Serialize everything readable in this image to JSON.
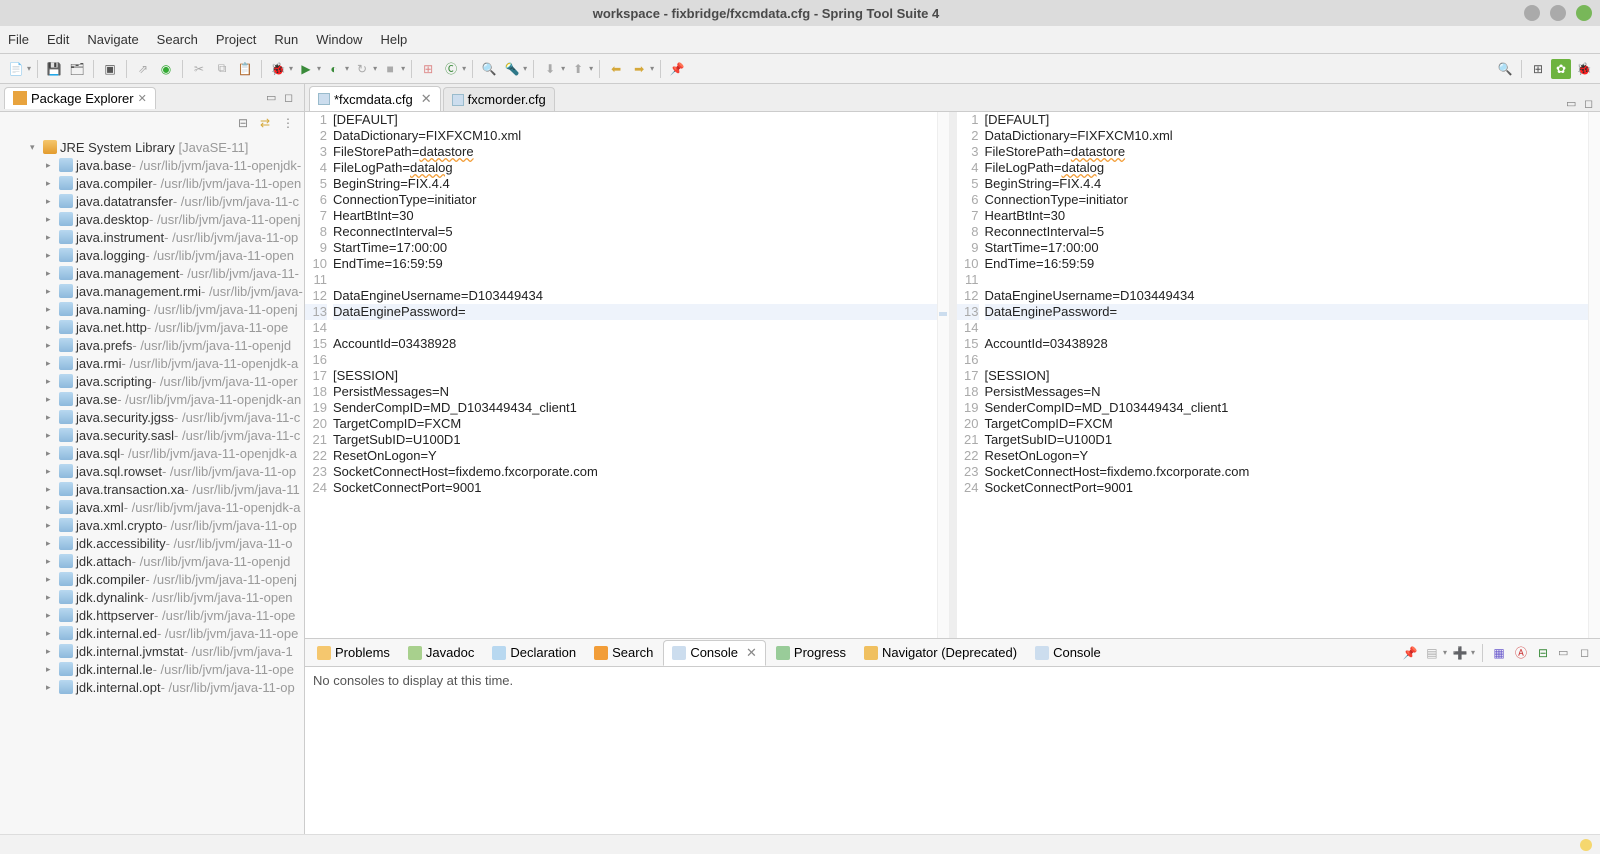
{
  "window": {
    "title": "workspace - fixbridge/fxcmdata.cfg - Spring Tool Suite 4"
  },
  "menu": [
    "File",
    "Edit",
    "Navigate",
    "Search",
    "Project",
    "Run",
    "Window",
    "Help"
  ],
  "sidebar": {
    "title": "Package Explorer",
    "library": {
      "name": "JRE System Library",
      "profile": "[JavaSE-11]"
    },
    "jars": [
      {
        "name": "java.base",
        "path": " - /usr/lib/jvm/java-11-openjdk-"
      },
      {
        "name": "java.compiler",
        "path": " - /usr/lib/jvm/java-11-open"
      },
      {
        "name": "java.datatransfer",
        "path": " - /usr/lib/jvm/java-11-c"
      },
      {
        "name": "java.desktop",
        "path": " - /usr/lib/jvm/java-11-openj"
      },
      {
        "name": "java.instrument",
        "path": " - /usr/lib/jvm/java-11-op"
      },
      {
        "name": "java.logging",
        "path": " - /usr/lib/jvm/java-11-open"
      },
      {
        "name": "java.management",
        "path": " - /usr/lib/jvm/java-11-"
      },
      {
        "name": "java.management.rmi",
        "path": " - /usr/lib/jvm/java-"
      },
      {
        "name": "java.naming",
        "path": " - /usr/lib/jvm/java-11-openj"
      },
      {
        "name": "java.net.http",
        "path": " - /usr/lib/jvm/java-11-ope"
      },
      {
        "name": "java.prefs",
        "path": " - /usr/lib/jvm/java-11-openjd"
      },
      {
        "name": "java.rmi",
        "path": " - /usr/lib/jvm/java-11-openjdk-a"
      },
      {
        "name": "java.scripting",
        "path": " - /usr/lib/jvm/java-11-oper"
      },
      {
        "name": "java.se",
        "path": " - /usr/lib/jvm/java-11-openjdk-an"
      },
      {
        "name": "java.security.jgss",
        "path": " - /usr/lib/jvm/java-11-c"
      },
      {
        "name": "java.security.sasl",
        "path": " - /usr/lib/jvm/java-11-c"
      },
      {
        "name": "java.sql",
        "path": " - /usr/lib/jvm/java-11-openjdk-a"
      },
      {
        "name": "java.sql.rowset",
        "path": " - /usr/lib/jvm/java-11-op"
      },
      {
        "name": "java.transaction.xa",
        "path": " - /usr/lib/jvm/java-11"
      },
      {
        "name": "java.xml",
        "path": " - /usr/lib/jvm/java-11-openjdk-a"
      },
      {
        "name": "java.xml.crypto",
        "path": " - /usr/lib/jvm/java-11-op"
      },
      {
        "name": "jdk.accessibility",
        "path": " - /usr/lib/jvm/java-11-o"
      },
      {
        "name": "jdk.attach",
        "path": " - /usr/lib/jvm/java-11-openjd"
      },
      {
        "name": "jdk.compiler",
        "path": " - /usr/lib/jvm/java-11-openj"
      },
      {
        "name": "jdk.dynalink",
        "path": " - /usr/lib/jvm/java-11-open"
      },
      {
        "name": "jdk.httpserver",
        "path": " - /usr/lib/jvm/java-11-ope"
      },
      {
        "name": "jdk.internal.ed",
        "path": " - /usr/lib/jvm/java-11-ope"
      },
      {
        "name": "jdk.internal.jvmstat",
        "path": " - /usr/lib/jvm/java-1"
      },
      {
        "name": "jdk.internal.le",
        "path": " - /usr/lib/jvm/java-11-ope"
      },
      {
        "name": "jdk.internal.opt",
        "path": " - /usr/lib/jvm/java-11-op"
      }
    ]
  },
  "editor": {
    "tabs": [
      {
        "label": "*fxcmdata.cfg",
        "active": true
      },
      {
        "label": "fxcmorder.cfg",
        "active": false
      }
    ],
    "lines": [
      "[DEFAULT]",
      "DataDictionary=FIXFXCM10.xml",
      "FileStorePath=datastore",
      "FileLogPath=datalog",
      "BeginString=FIX.4.4",
      "ConnectionType=initiator",
      "HeartBtInt=30",
      "ReconnectInterval=5",
      "StartTime=17:00:00",
      "EndTime=16:59:59",
      "",
      "DataEngineUsername=D103449434",
      "DataEnginePassword=",
      "",
      "AccountId=03438928",
      "",
      "[SESSION]",
      "PersistMessages=N",
      "SenderCompID=MD_D103449434_client1",
      "TargetCompID=FXCM",
      "TargetSubID=U100D1",
      "ResetOnLogon=Y",
      "SocketConnectHost=fixdemo.fxcorporate.com",
      "SocketConnectPort=9001"
    ],
    "highlighted_line_index": 12
  },
  "bottom": {
    "tabs": [
      "Problems",
      "Javadoc",
      "Declaration",
      "Search",
      "Console",
      "Progress",
      "Navigator (Deprecated)",
      "Console"
    ],
    "active_index": 4,
    "message": "No consoles to display at this time."
  }
}
